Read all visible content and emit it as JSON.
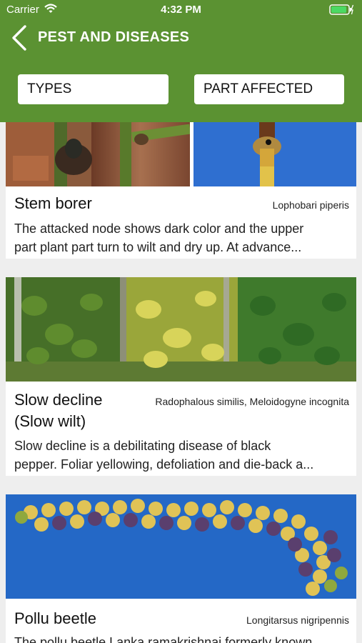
{
  "status": {
    "carrier": "Carrier",
    "time": "4:32 PM"
  },
  "header": {
    "title": "PEST AND DISEASES",
    "filters": [
      {
        "label": "TYPES"
      },
      {
        "label": "PART AFFECTED"
      }
    ]
  },
  "colors": {
    "primary": "#5b9232",
    "background": "#eeeeee",
    "card": "#ffffff"
  },
  "items": [
    {
      "name": "Stem borer",
      "scientific": "Lophobari piperis",
      "description_line1": "The attacked node shows dark color and the upper",
      "description_line2": "part plant part turn to wilt and dry up.  At advance..."
    },
    {
      "name_line1": "Slow decline",
      "name_line2": "(Slow wilt)",
      "scientific": "Radophalous similis, Meloidogyne incognita",
      "description_line1": "Slow decline is a debilitating disease of black",
      "description_line2": "pepper. Foliar yellowing, defoliation and die-back a..."
    },
    {
      "name": "Pollu beetle",
      "scientific": "Longitarsus nigripennis",
      "description_line1": "The pollu beetle Lanka ramakrishnai formerly known"
    }
  ]
}
